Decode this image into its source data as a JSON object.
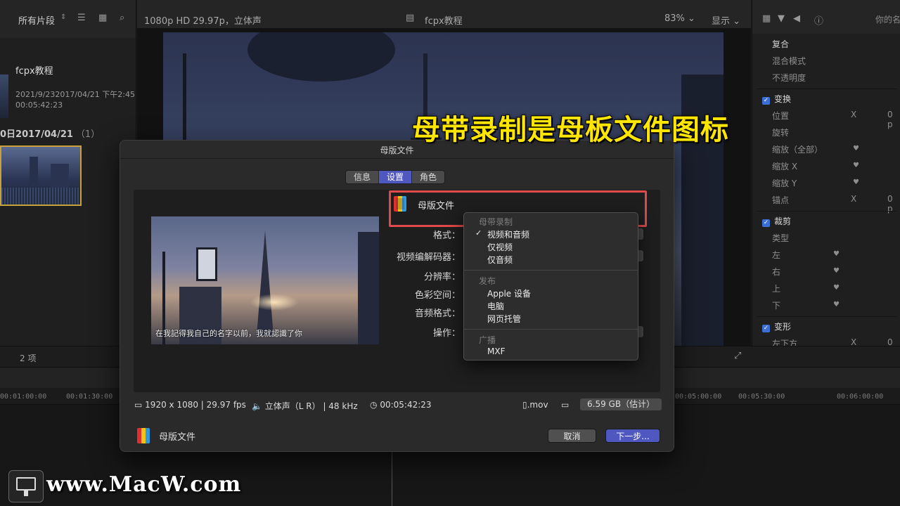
{
  "library": {
    "title": "所有片段",
    "project_name": "fcpx教程",
    "project_dates": "2021/9/232017/04/21 下午2:45",
    "project_duration": "00:05:42:23",
    "group_title": "0日2017/04/21",
    "group_count": "（1）",
    "item_count": "2 项"
  },
  "viewer": {
    "format": "1080p HD 29.97p，立体声",
    "project_name": "fcpx教程",
    "zoom": "83%",
    "view_label": "显示"
  },
  "inspector": {
    "name_label": "你的名",
    "composite": "复合",
    "blend_mode": "混合模式",
    "opacity": "不透明度",
    "transform": "变换",
    "position": "位置",
    "rotation": "旋转",
    "scale_all": "缩放（全部）",
    "scale_x": "缩放 X",
    "scale_y": "缩放 Y",
    "anchor": "锚点",
    "crop": "裁剪",
    "type": "类型",
    "left": "左",
    "right": "右",
    "top": "上",
    "bottom": "下",
    "distort": "变形",
    "bottom_left": "左下方",
    "x_label": "X",
    "zero_value": "0 p"
  },
  "timeline": {
    "ruler": [
      "00:01:00:00",
      "00:01:30:00",
      "00:05:00:00",
      "00:05:30:00",
      "00:06:00:00"
    ]
  },
  "dialog": {
    "title": "母版文件",
    "tabs": [
      {
        "label": "信息",
        "active": false
      },
      {
        "label": "设置",
        "active": true
      },
      {
        "label": "角色",
        "active": false
      }
    ],
    "destination_name": "母版文件",
    "preview_subtitle": "在我記得我自己的名字以前，我就認識了你",
    "fields": {
      "format": "格式：",
      "video_codec": "视频编解码器：",
      "resolution": "分辨率：",
      "color_space": "色彩空间：",
      "audio_format": "音频格式：",
      "action": "操作："
    },
    "menu": {
      "section1": "母带录制",
      "item_video_audio": "视频和音频",
      "item_video_only": "仅视频",
      "item_audio_only": "仅音频",
      "section2": "发布",
      "item_apple": "Apple 设备",
      "item_computer": "电脑",
      "item_web": "网页托管",
      "section3": "广播",
      "item_mxf": "MXF",
      "checkmark": "✓"
    },
    "meta": {
      "resolution": "1920 x 1080",
      "fps": "29.97 fps",
      "audio": "立体声（L R）",
      "sample_rate": "48 kHz",
      "duration": "00:05:42:23",
      "extension": ".mov",
      "size": "6.59 GB（估计）"
    },
    "footer_name": "母版文件",
    "cancel_label": "取消",
    "next_label": "下一步..."
  },
  "overlay": {
    "annotation": "母带录制是母板文件图标",
    "watermark": "www.MacW.com"
  }
}
